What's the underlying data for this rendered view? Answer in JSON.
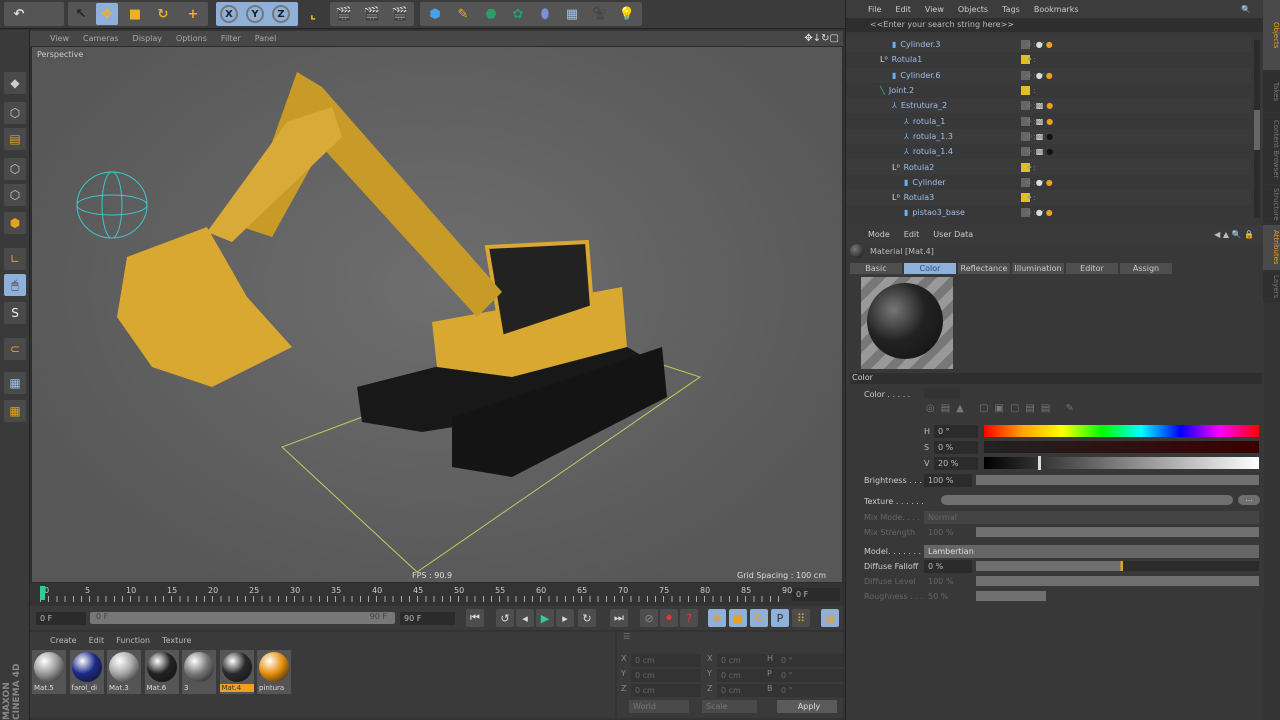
{
  "toolbar": {
    "axes": [
      "X",
      "Y",
      "Z"
    ]
  },
  "viewport": {
    "menu": [
      "View",
      "Cameras",
      "Display",
      "Options",
      "Filter",
      "Panel"
    ],
    "camera": "Perspective",
    "fps": "FPS : 90.9",
    "grid": "Grid Spacing : 100 cm"
  },
  "timeline": {
    "ticks": [
      "0",
      "5",
      "10",
      "15",
      "20",
      "25",
      "30",
      "35",
      "40",
      "45",
      "50",
      "55",
      "60",
      "65",
      "70",
      "75",
      "80",
      "85",
      "90"
    ],
    "current": "0 F",
    "start": "0 F",
    "range_start": "0 F",
    "range_end": "90 F",
    "end": "90 F"
  },
  "materials": {
    "menu": [
      "Create",
      "Edit",
      "Function",
      "Texture"
    ],
    "items": [
      {
        "name": "Mat.5",
        "color": "#9a9a9a",
        "selected": false
      },
      {
        "name": "farol_di",
        "color": "#1b2a8a",
        "selected": false
      },
      {
        "name": "Mat.3",
        "color": "#a8a8a8",
        "selected": false
      },
      {
        "name": "Mat.6",
        "color": "#222222",
        "selected": false
      },
      {
        "name": "3",
        "color": "#7a7a7a",
        "selected": false
      },
      {
        "name": "Mat.4",
        "color": "#2a2a2a",
        "selected": true
      },
      {
        "name": "pintura",
        "color": "#e89010",
        "selected": false
      }
    ]
  },
  "coords": {
    "rows": [
      [
        "X",
        "0 cm",
        "X",
        "0 cm",
        "H",
        "0 °"
      ],
      [
        "Y",
        "0 cm",
        "Y",
        "0 cm",
        "P",
        "0 °"
      ],
      [
        "Z",
        "0 cm",
        "Z",
        "0 cm",
        "B",
        "0 °"
      ]
    ],
    "world": "World",
    "scale": "Scale",
    "apply": "Apply"
  },
  "brand": "MAXON CINEMA 4D",
  "objects": {
    "menu": [
      "File",
      "Edit",
      "View",
      "Objects",
      "Tags",
      "Bookmarks"
    ],
    "search": "<<Enter your search string here>>",
    "rows": [
      {
        "name": "Cylinder.3",
        "indent": 3,
        "type": "cyl"
      },
      {
        "name": "Rotula1",
        "indent": 2,
        "type": "null"
      },
      {
        "name": "Cylinder.6",
        "indent": 3,
        "type": "cyl"
      },
      {
        "name": "Joint.2",
        "indent": 2,
        "type": "joint"
      },
      {
        "name": "Estrutura_2",
        "indent": 3,
        "type": "struct"
      },
      {
        "name": "rotula_1",
        "indent": 4,
        "type": "struct"
      },
      {
        "name": "rotula_1.3",
        "indent": 4,
        "type": "struct"
      },
      {
        "name": "rotula_1.4",
        "indent": 4,
        "type": "struct"
      },
      {
        "name": "Rotula2",
        "indent": 3,
        "type": "null"
      },
      {
        "name": "Cylinder",
        "indent": 4,
        "type": "cyl"
      },
      {
        "name": "Rotula3",
        "indent": 3,
        "type": "null"
      },
      {
        "name": "pistao3_base",
        "indent": 4,
        "type": "cyl"
      }
    ]
  },
  "attributes": {
    "menu": [
      "Mode",
      "Edit",
      "User Data"
    ],
    "title": "Material [Mat.4]",
    "tabs": [
      "Basic",
      "Color",
      "Reflectance",
      "Illumination",
      "Editor",
      "Assign"
    ],
    "active_tab": "Color",
    "section": "Color",
    "color_label": "Color . . . . .",
    "h_label": "H",
    "h": "0 °",
    "s_label": "S",
    "s": "0 %",
    "v_label": "V",
    "v": "20 %",
    "v_fraction": 0.2,
    "brightness_label": "Brightness . . .",
    "brightness": "100 %",
    "texture_label": "Texture . . . . . .",
    "texture_btn": "...",
    "mix_mode_label": "Mix Mode. . . .",
    "mix_mode": "Normal",
    "mix_strength_label": "Mix Strength",
    "mix_strength": "100 %",
    "model_label": "Model. . . . . . .",
    "model": "Lambertian",
    "diffuse_falloff_label": "Diffuse Falloff",
    "diffuse_falloff": "0 %",
    "diffuse_level_label": "Diffuse Level",
    "diffuse_level": "100 %",
    "roughness_label": "Roughness . . .",
    "roughness": "50 %"
  },
  "side_tabs": [
    "Objects",
    "Takes",
    "Content Browser",
    "Structure",
    "Attributes",
    "Layers"
  ],
  "colors": {
    "accent": "#8fb0d8",
    "orange": "#f0a020"
  }
}
